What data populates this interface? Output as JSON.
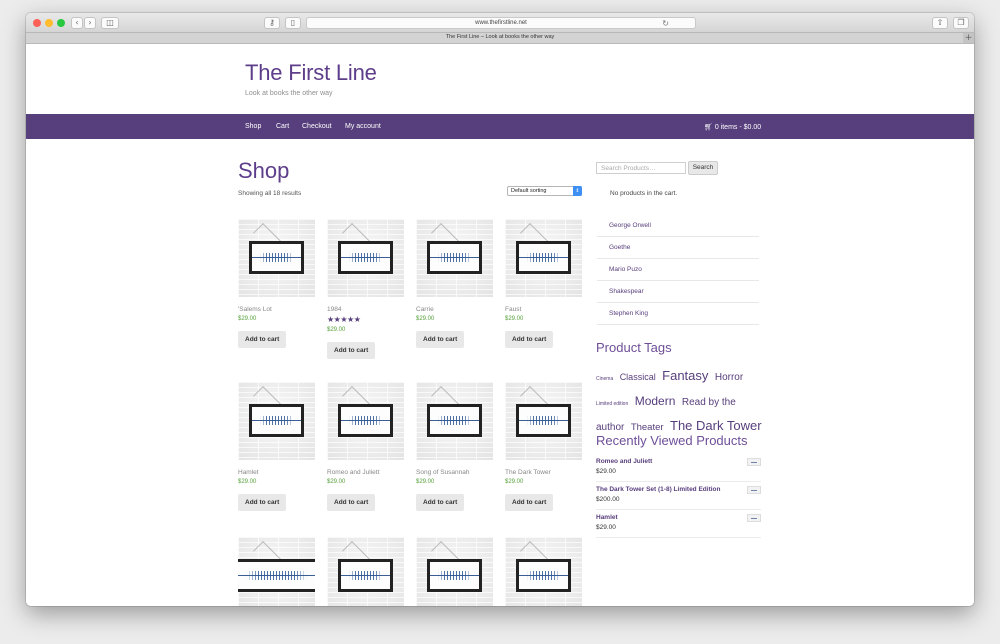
{
  "browser": {
    "url": "www.thefirstline.net",
    "tab_title": "The First Line – Look at books the other way",
    "back_icon": "chevron-left-icon",
    "forward_icon": "chevron-right-icon"
  },
  "site": {
    "title": "The First Line",
    "tagline": "Look at books the other way"
  },
  "nav": {
    "items": [
      "Shop",
      "Cart",
      "Checkout",
      "My account"
    ],
    "cart": "0 items - $0.00",
    "cart_icon": "cart-icon"
  },
  "shop": {
    "title": "Shop",
    "results": "Showing all 18 results",
    "sort": "Default sorting",
    "add_to_cart": "Add to cart",
    "products": [
      {
        "name": "'Salems Lot",
        "price": "$29.00",
        "rating": "★★★★★",
        "rating_value": 0
      },
      {
        "name": "1984",
        "price": "$29.00",
        "rating": "★★★★★",
        "rating_value": 5
      },
      {
        "name": "Carrie",
        "price": "$29.00",
        "rating": "★★★★★",
        "rating_value": 0
      },
      {
        "name": "Faust",
        "price": "$29.00",
        "rating": "★★★★★",
        "rating_value": 0
      },
      {
        "name": "Hamlet",
        "price": "$29.00",
        "rating": "★★★★★",
        "rating_value": 0
      },
      {
        "name": "Romeo and Juliett",
        "price": "$29.00",
        "rating": "★★★★★",
        "rating_value": 0
      },
      {
        "name": "Song of Susannah",
        "price": "$29.00",
        "rating": "★★★★★",
        "rating_value": 0
      },
      {
        "name": "The Dark Tower",
        "price": "$29.00",
        "rating": "★★★★★",
        "rating_value": 0
      },
      {
        "name": "",
        "price": "",
        "rating": "",
        "rating_value": 0
      },
      {
        "name": "",
        "price": "",
        "rating": "",
        "rating_value": 0
      },
      {
        "name": "",
        "price": "",
        "rating": "",
        "rating_value": 0
      },
      {
        "name": "",
        "price": "",
        "rating": "",
        "rating_value": 0
      }
    ]
  },
  "sidebar": {
    "search_placeholder": "Search Products…",
    "search_button": "Search",
    "no_products": "No products in the cart.",
    "categories": [
      "George Orwell",
      "Goethe",
      "Mario Puzo",
      "Shakespear",
      "Stephen King"
    ],
    "tags_title": "Product Tags",
    "tags": [
      "Cinema",
      "Classical",
      "Fantasy",
      "Horror",
      "Limited edition",
      "Modern",
      "Read by the author",
      "Theater",
      "The Dark Tower"
    ],
    "recent_title": "Recently Viewed Products",
    "recent": [
      {
        "name": "Romeo and Juliett",
        "price": "$29.00"
      },
      {
        "name": "The Dark Tower Set (1-8) Limited Edition",
        "price": "$200.00"
      },
      {
        "name": "Hamlet",
        "price": "$29.00"
      }
    ]
  },
  "colors": {
    "accent": "#573e7c",
    "price": "#56a03b",
    "brand_title": "#5e3e8a"
  }
}
